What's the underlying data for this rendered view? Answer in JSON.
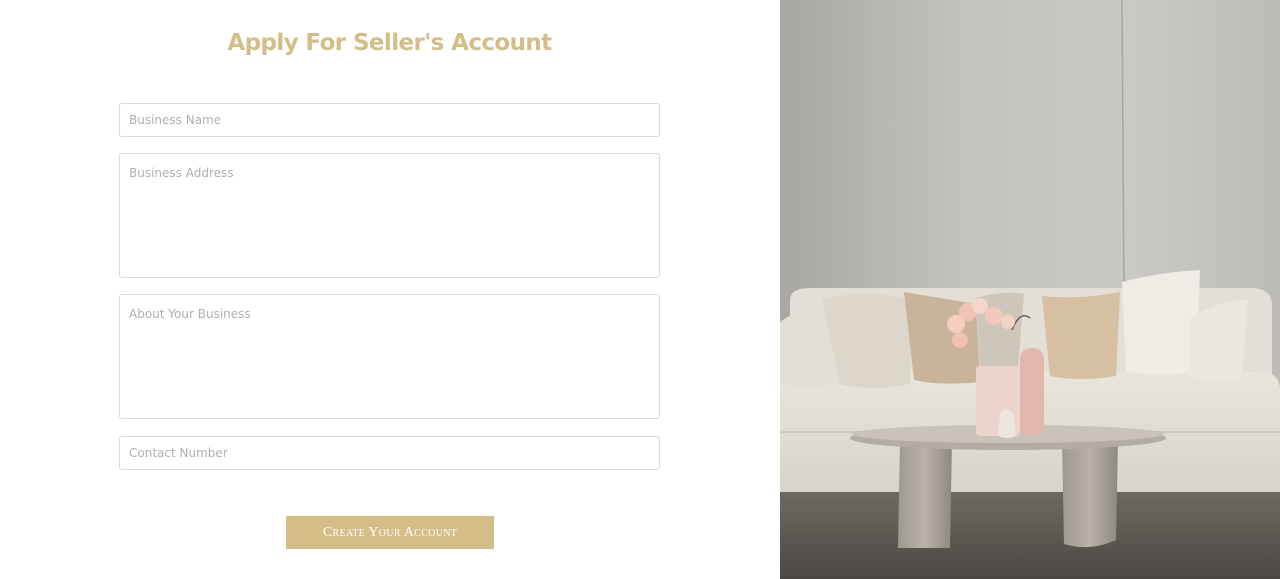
{
  "form": {
    "title": "Apply For Seller's Account",
    "business_name_placeholder": "Business Name",
    "business_address_placeholder": "Business Address",
    "about_business_placeholder": "About Your Business",
    "contact_number_placeholder": "Contact Number",
    "submit_label": "Create Your Account"
  },
  "colors": {
    "accent": "#d4bd87",
    "field_border": "#d9d9d9",
    "placeholder": "#b0b0b0"
  },
  "icons": [
    "living-room-photo"
  ]
}
